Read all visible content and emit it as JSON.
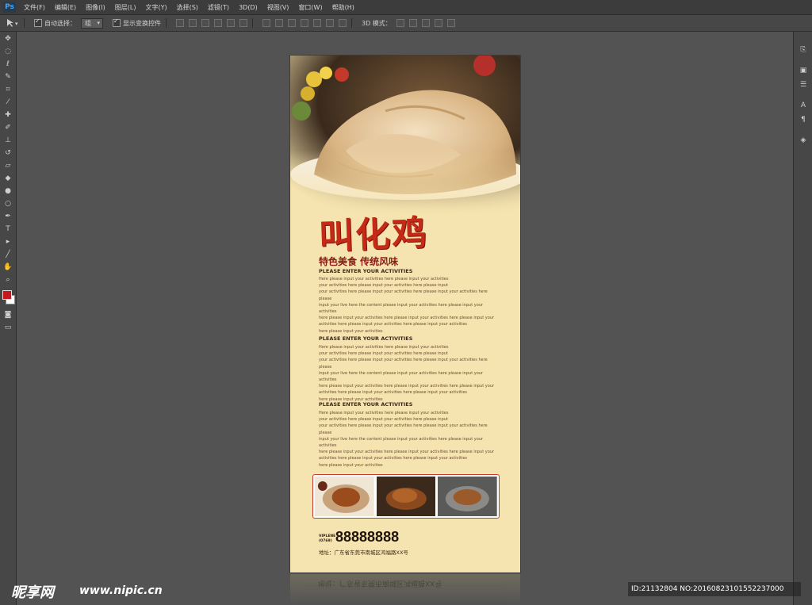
{
  "app": {
    "logo": "Ps"
  },
  "menu": [
    "文件(F)",
    "编辑(E)",
    "图像(I)",
    "图层(L)",
    "文字(Y)",
    "选择(S)",
    "滤镜(T)",
    "3D(D)",
    "视图(V)",
    "窗口(W)",
    "帮助(H)"
  ],
  "options": {
    "auto_select_label": "自动选择：",
    "auto_select_value": "组",
    "show_transform_label": "显示变换控件",
    "mode_3d_label": "3D 模式："
  },
  "poster": {
    "title": "叫化鸡",
    "subtitle": "特色美食 传统风味",
    "sections": [
      {
        "heading": "PLEASE ENTER YOUR ACTIVITIES",
        "lines": [
          "Here please input your activities here please input your activities",
          "your activities here please input your activities here please input",
          "your activities here please input your activities here please input your activities here please",
          "input your live here the content please input your activities here please input your activities",
          "here please input your activities here please input your activities here please input your",
          " activities here please input your activities here please input your activities",
          "here please input your activities"
        ]
      },
      {
        "heading": "PLEASE ENTER YOUR ACTIVITIES",
        "lines": [
          "Here please input your activities here please input your activities",
          "your activities here please input your activities here please input",
          "your activities here please input your activities here please input your activities here please",
          "input your live here the content please input your activities here please input your activities",
          "here please input your activities here please input your activities here please input your",
          " activities here please input your activities here please input your activities",
          "here please input your activities"
        ]
      },
      {
        "heading": "PLEASE ENTER YOUR ACTIVITIES",
        "lines": [
          "Here please input your activities here please input your activities",
          "your activities here please input your activities here please input",
          "your activities here please input your activities here please input your activities here please",
          "input your live here the content please input your activities here please input your activities",
          "here please input your activities here please input your activities here please input your",
          " activities here please input your activities here please input your activities",
          "here please input your activities"
        ]
      }
    ],
    "vip_label_line1": "VIPLENE",
    "vip_label_line2": "(0769)",
    "vip_number": "88888888",
    "address": "地址：广东省东莞市南城区鸿福路XX号",
    "reflection_text": "地址：广东省东莞市南城区鸿福路XX号"
  },
  "watermark": {
    "logo": "昵享网",
    "url": "www.nipic.cn",
    "id": "ID:21132804 NO:20160823101552237000"
  },
  "colors": {
    "poster_bg": "#f6e4b0",
    "title_red": "#c42a15",
    "subtitle_red": "#8a1a14",
    "thumb_border": "#c73a34",
    "fg_swatch": "#c8161d"
  },
  "icons": {
    "tools": [
      "move-icon",
      "marquee-icon",
      "lasso-icon",
      "quick-select-icon",
      "crop-icon",
      "eyedropper-icon",
      "healing-icon",
      "brush-icon",
      "stamp-icon",
      "history-brush-icon",
      "eraser-icon",
      "paint-bucket-icon",
      "blur-icon",
      "dodge-icon",
      "pen-icon",
      "type-icon",
      "path-select-icon",
      "line-icon",
      "hand-icon",
      "zoom-icon"
    ],
    "panels": [
      "history-icon",
      "adjustments-icon",
      "properties-icon",
      "character-icon",
      "paragraph-icon",
      "3d-icon"
    ]
  }
}
